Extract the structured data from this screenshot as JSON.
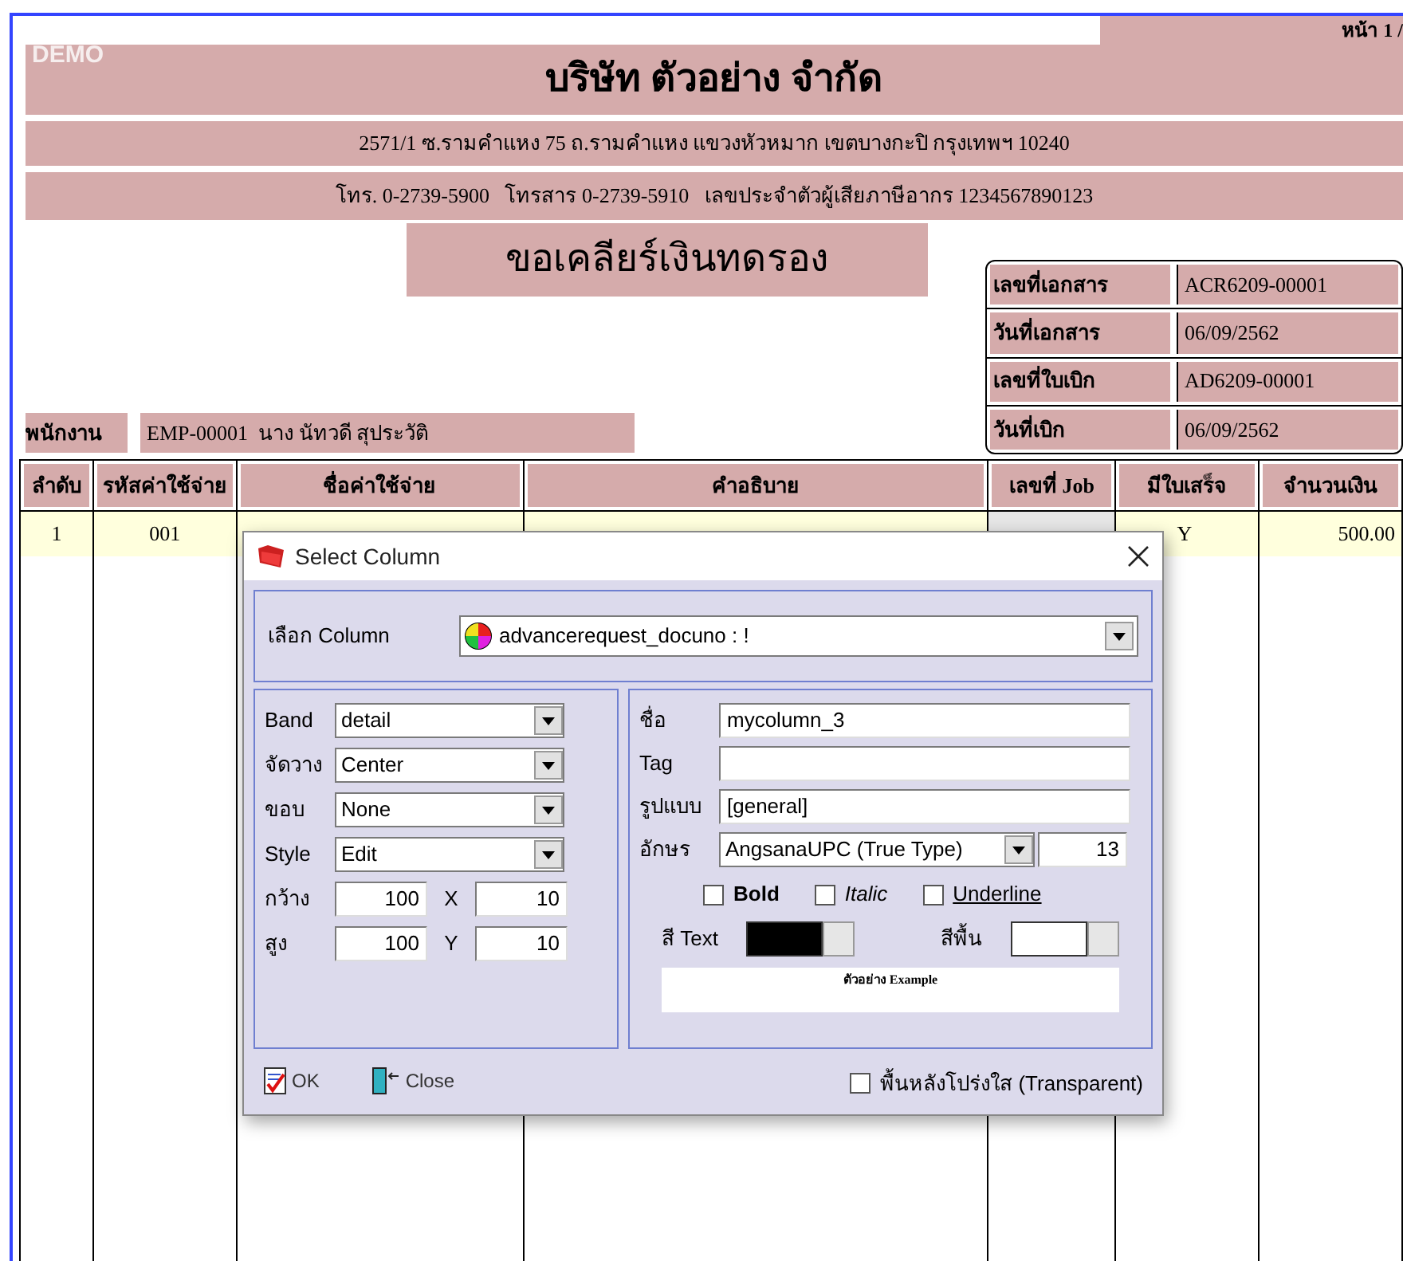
{
  "report": {
    "demo_mark": "DEMO",
    "page_label": "หน้า 1 /",
    "company_name": "บริษัท ตัวอย่าง จำกัด",
    "address": "2571/1 ซ.รามคำแหง 75 ถ.รามคำแหง แขวงหัวหมาก เขตบางกะปิ กรุงเทพฯ 10240",
    "contact": "โทร. 0-2739-5900   โทรสาร 0-2739-5910   เลขประจำตัวผู้เสียภาษีอากร 1234567890123",
    "document_title": "ขอเคลียร์เงินทดรอง",
    "doc_info": [
      {
        "label": "เลขที่เอกสาร",
        "value": "ACR6209-00001"
      },
      {
        "label": "วันที่เอกสาร",
        "value": "06/09/2562"
      },
      {
        "label": "เลขที่ใบเบิก",
        "value": "AD6209-00001"
      },
      {
        "label": "วันที่เบิก",
        "value": "06/09/2562"
      }
    ],
    "employee": {
      "label": "พนักงาน",
      "value": "EMP-00001  นาง นัทวดี สุประวัติ"
    },
    "table": {
      "columns": [
        "ลำดับ",
        "รหัสค่าใช้จ่าย",
        "ชื่อค่าใช้จ่าย",
        "คำอธิบาย",
        "เลขที่ Job",
        "มีใบเสร็จ",
        "จำนวนเงิน"
      ],
      "rows": [
        {
          "no": "1",
          "code": "001",
          "receipt": "Y",
          "amount": "500.00"
        }
      ]
    }
  },
  "dialog": {
    "title": "Select Column",
    "column_select": {
      "label": "เลือก Column",
      "value": "advancerequest_docuno : !"
    },
    "left_fields": [
      {
        "kind": "dropdown",
        "label": "Band",
        "value": "detail"
      },
      {
        "kind": "dropdown",
        "label": "จัดวาง",
        "value": "Center"
      },
      {
        "kind": "dropdown",
        "label": "ขอบ",
        "value": "None"
      },
      {
        "kind": "dropdown",
        "label": "Style",
        "value": "Edit"
      },
      {
        "kind": "pair",
        "label": "กว้าง",
        "value": "100",
        "label2": "X",
        "value2": "10"
      },
      {
        "kind": "pair",
        "label": "สูง",
        "value": "100",
        "label2": "Y",
        "value2": "10"
      }
    ],
    "right_fields": [
      {
        "label": "ชื่อ",
        "value": "mycolumn_3"
      },
      {
        "label": "Tag"
      },
      {
        "label": "รูปแบบ",
        "value": "[general]"
      }
    ],
    "font": {
      "label": "อักษร",
      "value": "AngsanaUPC (True Type)",
      "size": "13"
    },
    "styles": [
      {
        "kind": "bold",
        "label": "Bold",
        "checked": false
      },
      {
        "kind": "italic",
        "label": "Italic",
        "checked": false
      },
      {
        "kind": "underline",
        "label": "Underline",
        "checked": false
      }
    ],
    "colors": [
      {
        "label": "สี Text",
        "color": "#000000"
      },
      {
        "label": "สีพื้น",
        "color": "#ffffff"
      }
    ],
    "preview": "ตัวอย่าง Example",
    "buttons": [
      {
        "kind": "ok",
        "label": "OK"
      },
      {
        "kind": "close",
        "label": "Close"
      }
    ],
    "transparent": {
      "label": "พื้นหลังโปร่งใส (Transparent)",
      "checked": false
    }
  }
}
